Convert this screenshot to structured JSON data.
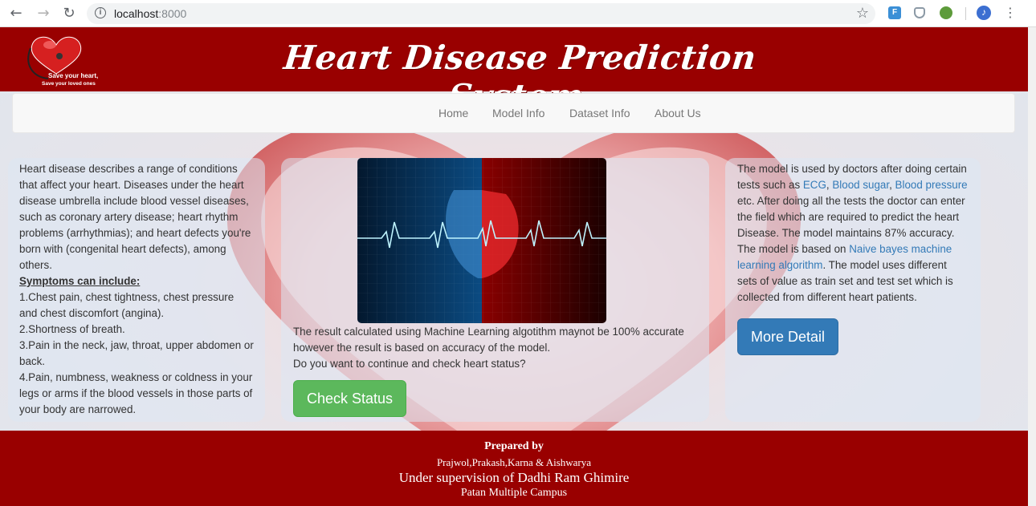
{
  "browser": {
    "url_host": "localhost",
    "url_port": ":8000",
    "icons": [
      "back-arrow-icon",
      "forward-arrow-icon",
      "reload-icon",
      "info-icon",
      "star-icon",
      "extension-icon",
      "menu-icon"
    ]
  },
  "header": {
    "title": "Heart Disease Prediction System",
    "logo_line1": "Save your heart,",
    "logo_line2": "Save your loved ones",
    "background_color": "#990000"
  },
  "nav": {
    "items": [
      {
        "label": "Home"
      },
      {
        "label": "Model Info"
      },
      {
        "label": "Dataset Info"
      },
      {
        "label": "About Us"
      }
    ]
  },
  "left_panel": {
    "intro": "Heart disease describes a range of conditions that affect your heart. Diseases under the heart disease umbrella include blood vessel diseases, such as coronary artery disease; heart rhythm problems (arrhythmias); and heart defects you're born with (congenital heart defects), among others.",
    "symptoms_heading": "Symptoms can include:",
    "symptoms": [
      "1.Chest pain, chest tightness, chest pressure and chest discomfort (angina).",
      "2.Shortness of breath.",
      "3.Pain in the neck, jaw, throat, upper abdomen or back.",
      "4.Pain, numbness, weakness or coldness in your legs or arms if the blood vessels in those parts of your body are narrowed."
    ]
  },
  "center_panel": {
    "result_line1": "The result calculated using Machine Learning algotithm maynot be 100% accurate however the result is based on accuracy of the model.",
    "result_line2": "Do you want to continue and check heart status?",
    "check_button": "Check Status",
    "check_button_color": "#5cb85c"
  },
  "right_panel": {
    "t1": "The model is used by doctors after doing certain tests such as ",
    "link_ecg": "ECG",
    "sep1": ", ",
    "link_sugar": "Blood sugar",
    "sep2": ", ",
    "link_pressure": "Blood pressure",
    "t2": " etc. After doing all the tests the doctor can enter the field which are required to predict the heart Disease. The model maintains 87% accuracy. The model is based on ",
    "link_naive": "Naive bayes machine learning algorithm",
    "t3": ". The model uses different sets of value as train set and test set which is collected from different heart patients.",
    "more_button": "More Detail",
    "more_button_color": "#337ab7"
  },
  "footer": {
    "prepared": "Prepared by",
    "names": "Prajwol,Prakash,Karna & Aishwarya",
    "supervision": "Under supervision of Dadhi Ram Ghimire",
    "campus": "Patan Multiple Campus"
  }
}
